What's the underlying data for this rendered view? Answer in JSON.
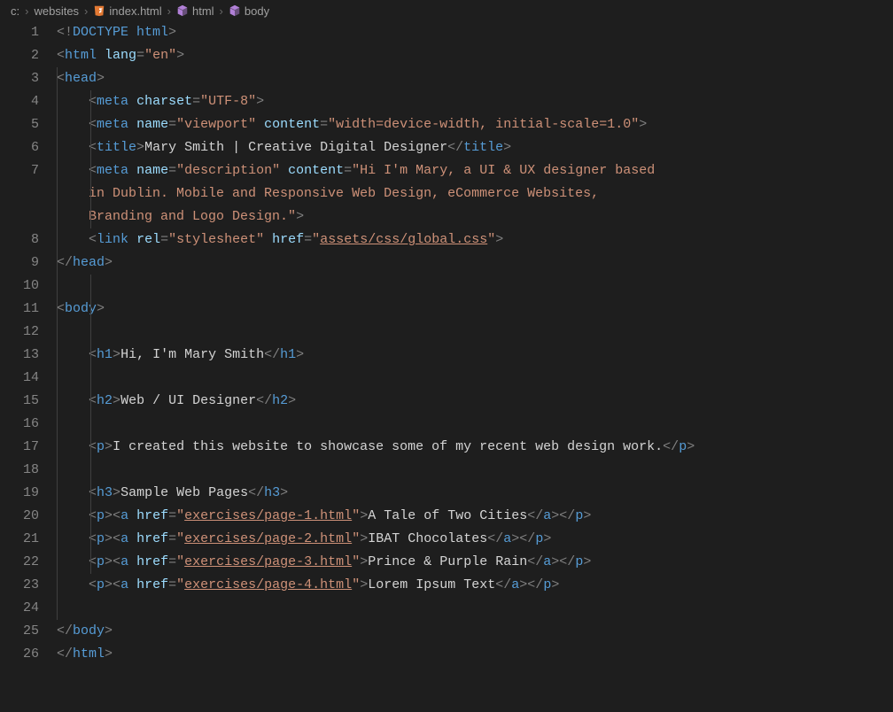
{
  "breadcrumb": {
    "drive": "c:",
    "folder": "websites",
    "file": "index.html",
    "element1": "html",
    "element2": "body"
  },
  "gutter": [
    "1",
    "2",
    "3",
    "4",
    "5",
    "6",
    "7",
    "",
    "",
    "8",
    "9",
    "10",
    "11",
    "12",
    "13",
    "14",
    "15",
    "16",
    "17",
    "18",
    "19",
    "20",
    "21",
    "22",
    "23",
    "24",
    "25",
    "26"
  ],
  "code": {
    "doctype_open": "<!",
    "doctype_name": "DOCTYPE",
    "doctype_html": " html",
    "doctype_close": ">",
    "html_tag": "html",
    "lang_attr": "lang",
    "lang_val": "\"en\"",
    "head_tag": "head",
    "meta_tag": "meta",
    "charset_attr": "charset",
    "charset_val": "\"UTF-8\"",
    "name_attr": "name",
    "viewport_val": "\"viewport\"",
    "content_attr": "content",
    "viewport_content": "\"width=device-width, initial-scale=1.0\"",
    "title_tag": "title",
    "title_text": "Mary Smith | Creative Digital Designer",
    "desc_val": "\"description\"",
    "desc_content_a": "\"Hi I'm Mary, a UI & UX designer based ",
    "desc_content_b": "in Dublin. Mobile and Responsive Web Design, eCommerce Websites, ",
    "desc_content_c": "Branding and Logo Design.\"",
    "link_tag": "link",
    "rel_attr": "rel",
    "rel_val": "\"stylesheet\"",
    "href_attr": "href",
    "css_href_q1": "\"",
    "css_href_path": "assets/css/global.css",
    "css_href_q2": "\"",
    "body_tag": "body",
    "h1_tag": "h1",
    "h1_text": "Hi, I'm Mary Smith",
    "h2_tag": "h2",
    "h2_text": "Web / UI Designer",
    "p_tag": "p",
    "p1_text": "I created this website to showcase some of my recent web design work.",
    "h3_tag": "h3",
    "h3_text": "Sample Web Pages",
    "a_tag": "a",
    "href_q1": "\"",
    "href_q2": "\"",
    "link1_href": "exercises/page-1.html",
    "link1_text": "A Tale of Two Cities",
    "link2_href": "exercises/page-2.html",
    "link2_text": "IBAT Chocolates",
    "link3_href": "exercises/page-3.html",
    "link3_text": "Prince & Purple Rain",
    "link4_href": "exercises/page-4.html",
    "link4_text": "Lorem Ipsum Text"
  }
}
